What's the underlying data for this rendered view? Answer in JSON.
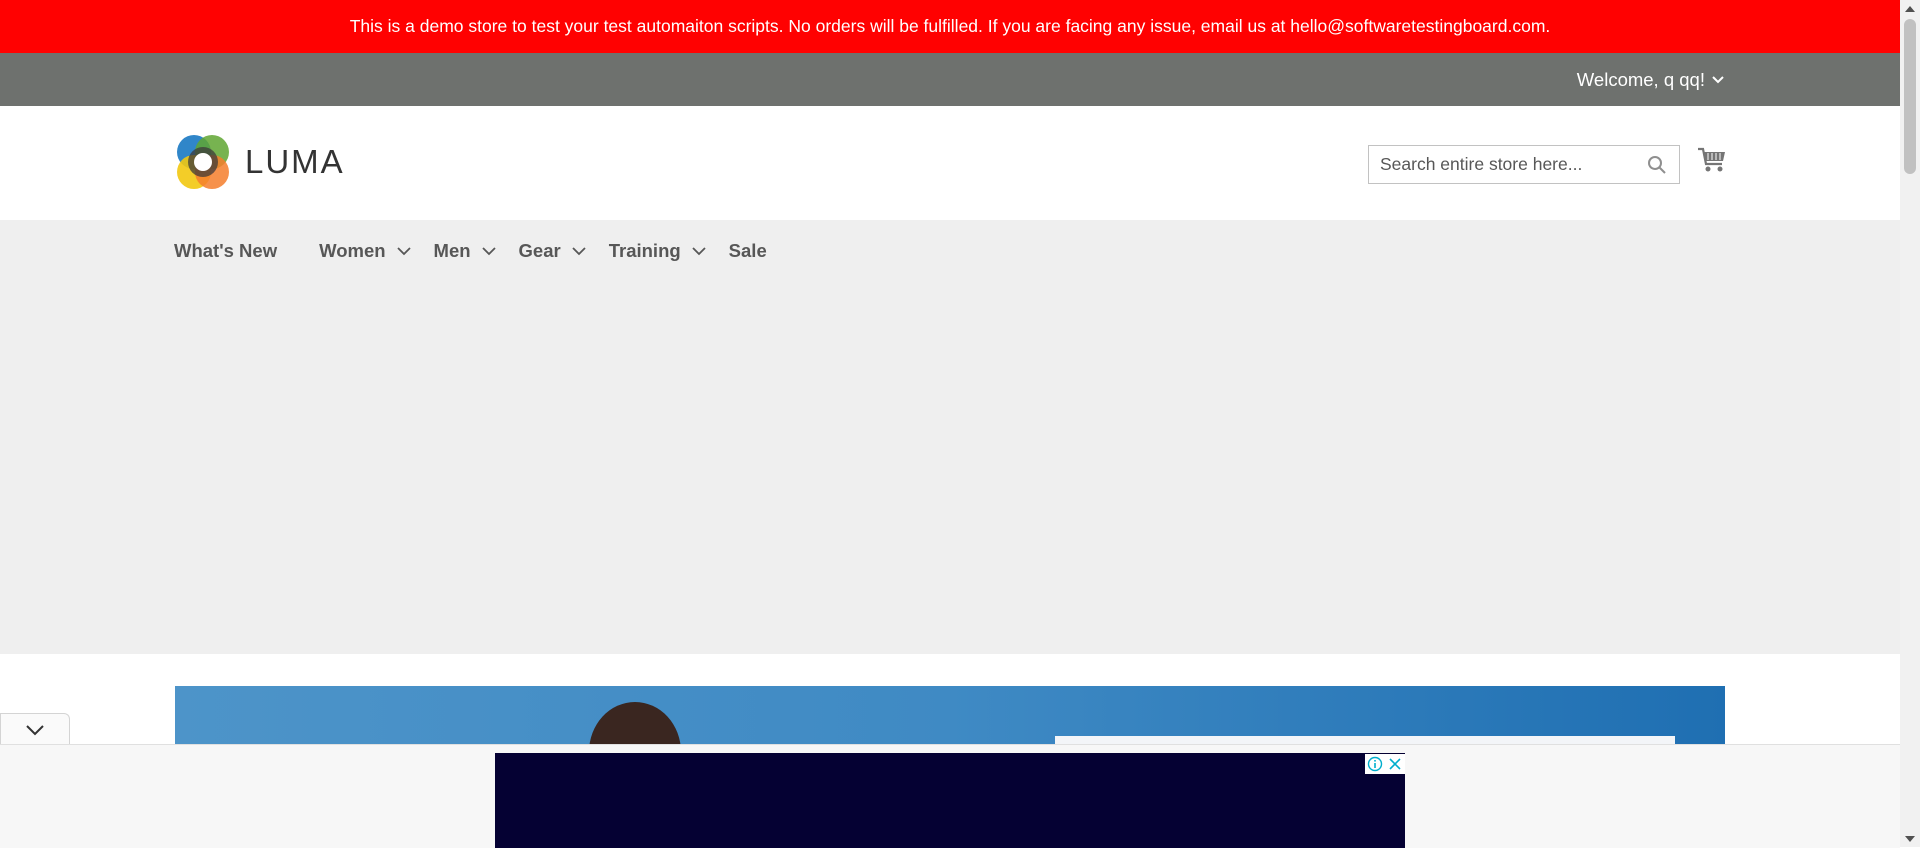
{
  "demo_notice": {
    "text": "This is a demo store to test your test automaiton scripts. No orders will be fulfilled. If you are facing any issue, email us at hello@softwaretestingboard.com."
  },
  "header_panel": {
    "welcome": "Welcome, q qq!"
  },
  "header": {
    "logo_text": "LUMA",
    "search_placeholder": "Search entire store here..."
  },
  "nav": {
    "items": [
      {
        "label": "What's New"
      },
      {
        "label": "Women"
      },
      {
        "label": "Men"
      },
      {
        "label": "Gear"
      },
      {
        "label": "Training"
      },
      {
        "label": "Sale"
      }
    ]
  },
  "colors": {
    "notice_bg": "#ff0101",
    "panel_bg": "#6e716e",
    "nav_bg": "#efefef",
    "ad_bg": "#050133"
  },
  "icons": [
    "chevron-down-icon",
    "search-icon",
    "cart-icon",
    "info-icon",
    "close-icon",
    "collapse-icon",
    "scroll-up-icon",
    "scroll-down-icon"
  ]
}
